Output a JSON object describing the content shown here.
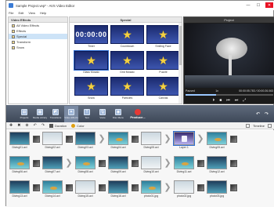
{
  "window": {
    "title": "Sample Project.vep* - AVS Video Editor",
    "buttons": [
      "—",
      "☐",
      "✕"
    ]
  },
  "menu": [
    "File",
    "Edit",
    "View",
    "Help"
  ],
  "left_panel": {
    "header": "Video Effects",
    "items": [
      {
        "label": "All Video Effects",
        "selected": false
      },
      {
        "label": "Effects",
        "selected": false
      },
      {
        "label": "Special",
        "selected": true
      },
      {
        "label": "Transform",
        "selected": false
      },
      {
        "label": "Snow",
        "selected": false
      }
    ]
  },
  "effects_panel": {
    "header": "Special",
    "tiles": [
      {
        "label": "Timer",
        "kind": "digits",
        "text": "00:00:00"
      },
      {
        "label": "Countdown",
        "kind": "star",
        "text": "6"
      },
      {
        "label": "Smiling Face",
        "kind": "star",
        "text": ""
      },
      {
        "label": "Glass Mosaic",
        "kind": "star",
        "text": ""
      },
      {
        "label": "Grid Mosaic",
        "kind": "star",
        "text": ""
      },
      {
        "label": "Puzzle",
        "kind": "star",
        "text": ""
      },
      {
        "label": "Snow",
        "kind": "star",
        "text": ""
      },
      {
        "label": "Particles",
        "kind": "star",
        "text": ""
      },
      {
        "label": "Canvas",
        "kind": "star",
        "text": ""
      }
    ]
  },
  "preview": {
    "header": "Project",
    "state": "Paused",
    "speed": "1x",
    "time": "00:00:05.783 / 00:00:26.063",
    "seek_fraction": 0.35,
    "controls": [
      "⏵",
      "■",
      "⏮",
      "⏭",
      "⤢"
    ]
  },
  "ribbon": {
    "tools": [
      {
        "label": "Projects",
        "glyph": "▤"
      },
      {
        "label": "Media Library",
        "glyph": "▦"
      },
      {
        "label": "Transitions",
        "glyph": "◩"
      },
      {
        "label": "Video Effects",
        "glyph": "✦"
      },
      {
        "label": "Text",
        "glyph": "T"
      },
      {
        "label": "Voice",
        "glyph": "🎙"
      },
      {
        "label": "Disc Menu",
        "glyph": "◉"
      }
    ],
    "produce_label": "Produce...",
    "right_icons": [
      "↶",
      "↷"
    ]
  },
  "storyboard_toolbar": {
    "left_icons": [
      "✚",
      "✖",
      "⊗",
      "↶",
      "↷"
    ],
    "duration_label": "Duration",
    "color_label": "Color",
    "view_label": "Timeline"
  },
  "storyboard": {
    "rows": [
      [
        {
          "type": "clip",
          "label": "Diving01.avi",
          "style": "dark"
        },
        {
          "type": "trans"
        },
        {
          "type": "clip",
          "label": "Diving02.avi",
          "style": "light"
        },
        {
          "type": "trans"
        },
        {
          "type": "clip",
          "label": "Diving03.avi",
          "style": "dark"
        },
        {
          "type": "arrow"
        },
        {
          "type": "clip",
          "label": "Diving04.avi",
          "style": ""
        },
        {
          "type": "trans"
        },
        {
          "type": "clip",
          "label": "Diving05.avi",
          "style": "light"
        },
        {
          "type": "arrow"
        },
        {
          "type": "clip",
          "label": "Layer 1",
          "style": "purple"
        },
        {
          "type": "arrow"
        },
        {
          "type": "clip",
          "label": "Diving05.avi",
          "style": ""
        },
        {
          "type": "trans"
        }
      ],
      [
        {
          "type": "clip",
          "label": "Diving06.avi",
          "style": ""
        },
        {
          "type": "trans"
        },
        {
          "type": "clip",
          "label": "Diving07.avi",
          "style": "dark"
        },
        {
          "type": "arrow"
        },
        {
          "type": "clip",
          "label": "Diving08.avi",
          "style": ""
        },
        {
          "type": "trans"
        },
        {
          "type": "clip",
          "label": "Diving09.avi",
          "style": "dark"
        },
        {
          "type": "trans"
        },
        {
          "type": "clip",
          "label": "Diving10.avi",
          "style": "light"
        },
        {
          "type": "arrow"
        },
        {
          "type": "clip",
          "label": "Diving11.avi",
          "style": ""
        },
        {
          "type": "trans"
        },
        {
          "type": "clip",
          "label": "Diving12.avi",
          "style": "dark"
        },
        {
          "type": "trans"
        }
      ],
      [
        {
          "type": "clip",
          "label": "Diving13.avi",
          "style": "dark"
        },
        {
          "type": "trans"
        },
        {
          "type": "clip",
          "label": "Diving14.avi",
          "style": ""
        },
        {
          "type": "trans"
        },
        {
          "type": "clip",
          "label": "Diving15.avi",
          "style": "light"
        },
        {
          "type": "trans"
        },
        {
          "type": "clip",
          "label": "Diving16.avi",
          "style": "dark"
        },
        {
          "type": "trans"
        },
        {
          "type": "clip",
          "label": "photo01.jpg",
          "style": ""
        },
        {
          "type": "arrow"
        },
        {
          "type": "clip",
          "label": "photo02.jpg",
          "style": "light"
        },
        {
          "type": "trans"
        },
        {
          "type": "clip",
          "label": "photo03.jpg",
          "style": "dark"
        },
        {
          "type": "trans"
        }
      ]
    ]
  },
  "colors": {
    "ribbon": "#4f5a6b",
    "accent": "#2e6cd1",
    "thumb_bg": "#1b2a6e",
    "star": "#f5d142"
  }
}
